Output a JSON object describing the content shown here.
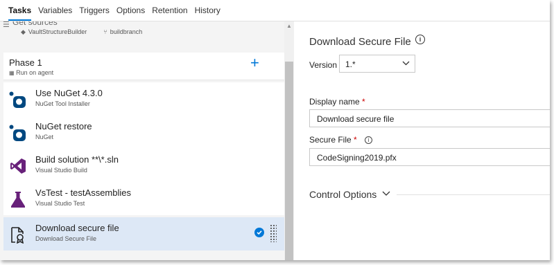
{
  "tabs": [
    {
      "label": "Tasks",
      "active": true
    },
    {
      "label": "Variables",
      "active": false
    },
    {
      "label": "Triggers",
      "active": false
    },
    {
      "label": "Options",
      "active": false
    },
    {
      "label": "Retention",
      "active": false
    },
    {
      "label": "History",
      "active": false
    }
  ],
  "sources": {
    "title": "Get sources",
    "repo": "VaultStructureBuilder",
    "branch": "buildbranch"
  },
  "phase": {
    "title": "Phase 1",
    "subtitle": "Run on agent",
    "add_label": "+"
  },
  "tasks": [
    {
      "name": "Use NuGet 4.3.0",
      "type": "NuGet Tool Installer",
      "icon": "nuget-icon"
    },
    {
      "name": "NuGet restore",
      "type": "NuGet",
      "icon": "nuget-icon"
    },
    {
      "name": "Build solution **\\*.sln",
      "type": "Visual Studio Build",
      "icon": "visual-studio-icon"
    },
    {
      "name": "VsTest - testAssemblies",
      "type": "Visual Studio Test",
      "icon": "flask-icon"
    },
    {
      "name": "Download secure file",
      "type": "Download Secure File",
      "icon": "secure-file-icon",
      "selected": true
    }
  ],
  "details": {
    "title": "Download Secure File",
    "version_label": "Version",
    "version_value": "1.*",
    "display_name_label": "Display name",
    "display_name_value": "Download secure file",
    "secure_file_label": "Secure File",
    "secure_file_value": "CodeSigning2019.pfx",
    "control_options_label": "Control Options",
    "required_mark": "*"
  },
  "colors": {
    "accent": "#0078d7",
    "selected_row": "#dde8f6",
    "required": "#cc0000"
  }
}
